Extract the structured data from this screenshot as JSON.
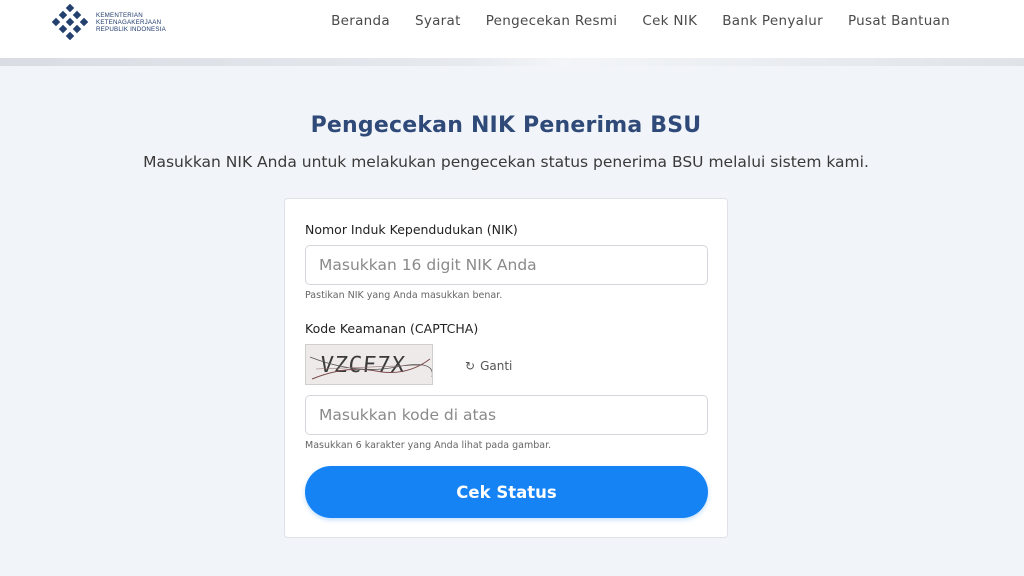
{
  "header": {
    "logo_lines": [
      "KEMENTERIAN",
      "KETENAGAKERJAAN",
      "REPUBLIK INDONESIA"
    ],
    "nav": [
      "Beranda",
      "Syarat",
      "Pengecekan Resmi",
      "Cek NIK",
      "Bank Penyalur",
      "Pusat Bantuan"
    ]
  },
  "main": {
    "title": "Pengecekan NIK Penerima BSU",
    "subtitle": "Masukkan NIK Anda untuk melakukan pengecekan status penerima BSU melalui sistem kami."
  },
  "form": {
    "nik_label": "Nomor Induk Kependudukan (NIK)",
    "nik_placeholder": "Masukkan 16 digit NIK Anda",
    "nik_value": "",
    "nik_hint": "Pastikan NIK yang Anda masukkan benar.",
    "captcha_label": "Kode Keamanan (CAPTCHA)",
    "captcha_code": "VZCF7X",
    "refresh_label": "Ganti",
    "captcha_placeholder": "Masukkan kode di atas",
    "captcha_value": "",
    "captcha_hint": "Masukkan 6 karakter yang Anda lihat pada gambar.",
    "submit_label": "Cek Status"
  },
  "colors": {
    "accent": "#1683f5",
    "title": "#2f4a78",
    "background": "#f1f4f8"
  },
  "icons": {
    "logo": "ministry-logo-icon",
    "refresh": "refresh-icon"
  }
}
